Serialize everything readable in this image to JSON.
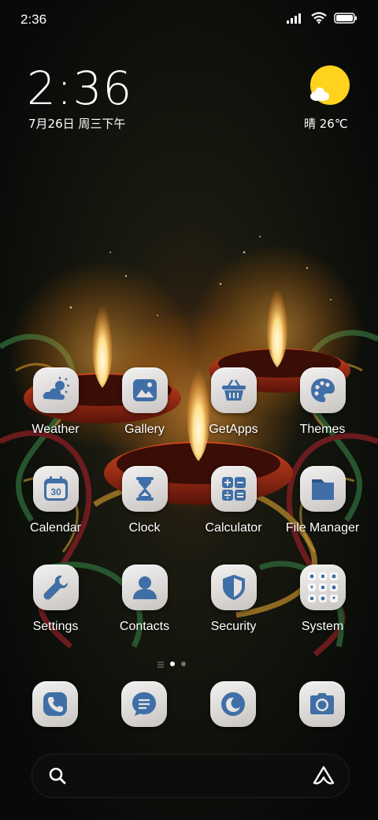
{
  "status_bar": {
    "time": "2:36",
    "icons": [
      "signal-icon",
      "wifi-icon",
      "battery-icon"
    ]
  },
  "clock_widget": {
    "time": "2:36",
    "date": "7月26日 周三下午"
  },
  "weather_widget": {
    "icon": "sun-cloud-icon",
    "condition_temp": "晴 26℃"
  },
  "apps": [
    {
      "label": "Weather",
      "icon": "weather-icon"
    },
    {
      "label": "Gallery",
      "icon": "gallery-icon"
    },
    {
      "label": "GetApps",
      "icon": "basket-icon"
    },
    {
      "label": "Themes",
      "icon": "palette-icon"
    },
    {
      "label": "Calendar",
      "icon": "calendar-icon",
      "icon_text": "30"
    },
    {
      "label": "Clock",
      "icon": "hourglass-icon"
    },
    {
      "label": "Calculator",
      "icon": "calculator-icon"
    },
    {
      "label": "File Manager",
      "icon": "folder-icon"
    },
    {
      "label": "Settings",
      "icon": "wrench-icon"
    },
    {
      "label": "Contacts",
      "icon": "person-icon"
    },
    {
      "label": "Security",
      "icon": "shield-icon"
    },
    {
      "label": "System",
      "icon": "app-folder-icon"
    }
  ],
  "page_indicator": {
    "pages": 2,
    "current": 1
  },
  "dock": [
    "phone-icon",
    "messages-icon",
    "browser-icon",
    "camera-icon"
  ],
  "search_bar": {
    "left_icon": "search-icon",
    "right_icon": "assistant-icon"
  },
  "colors": {
    "icon_glyph": "#3f6fa6",
    "icon_bg": "#e6e3e1",
    "sun": "#ffd21e"
  }
}
